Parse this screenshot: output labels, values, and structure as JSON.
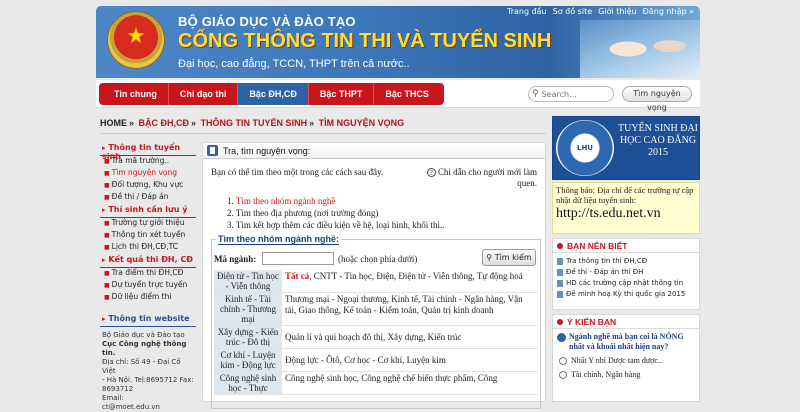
{
  "header": {
    "ministry": "BỘ GIÁO DỤC VÀ ĐÀO TẠO",
    "portal": "CỔNG THÔNG TIN THI VÀ TUYỂN SINH",
    "subtitle": "Đại học, cao đẳng, TCCN, THPT trên cả nước..",
    "top_links": [
      "Trang đầu",
      "Sơ đồ site",
      "Giới thiệu",
      "Đăng nhập »"
    ]
  },
  "nav": {
    "tabs": [
      "Tin chung",
      "Chỉ đạo thi",
      "Bậc ĐH,CĐ",
      "Bậc THPT",
      "Bậc THCS"
    ],
    "active": "Bậc ĐH,CĐ",
    "search_placeholder": "Search...",
    "search_button": "Tìm nguyện vọng"
  },
  "breadcrumb": [
    "HOME",
    "BẬC ĐH,CĐ",
    "THÔNG TIN TUYỂN SINH",
    "TÌM NGUYỆN VỌNG"
  ],
  "left": {
    "sec1_title": "Thông tin tuyển sinh",
    "sec1_items": [
      "Tra mã trường..",
      "Tìm nguyện vọng",
      "Đối tượng, Khu vực",
      "Đề thi / Đáp án"
    ],
    "sec2_title": "Thí sinh cần lưu ý",
    "sec2_items": [
      "Trường tự giới thiệu",
      "Thông tin xét tuyển",
      "Lịch thi ĐH,CĐ,TC"
    ],
    "sec3_title": "Kết quả thi ĐH, CĐ",
    "sec3_items": [
      "Tra điểm thi ĐH,CĐ",
      "Dự tuyển trực tuyến",
      "Dữ liệu điểm thi"
    ],
    "sec4_title": "Thông tin website",
    "contact": [
      "Bộ Giáo dục và Đào tạo",
      "Cục Công nghệ thông tin.",
      "Địa chỉ: Số 49 - Đại Cồ Việt",
      "- Hà Nội. Tel:8695712 Fax:",
      "8693712",
      "Email:",
      "ct@moet.edu.vn"
    ]
  },
  "main": {
    "title": "Tra, tìm nguyện vọng:",
    "intro": "Bạn có thể tìm theo một trong các cách sau đây.",
    "guide_line1": "Chỉ dẫn cho người mới làm",
    "guide_line2": "quen.",
    "options": [
      "Tìm theo nhóm ngành nghề",
      "Tìm theo địa phương (nơi trường đóng)",
      "Tìm kết hợp thêm các điều kiện về hệ, loại hình, khối thi.."
    ],
    "group_title": "Tìm theo nhóm ngành nghề:",
    "filter_label": "Mã ngành:",
    "filter_hint": "(hoặc chọn phía dưới)",
    "find_button": "Tìm kiếm",
    "rows": [
      {
        "label": "Điện tử - Tin học - Viễn thông",
        "all": "Tất cả",
        "value": ", CNTT - Tin học, Điện, Điện tử - Viễn thông, Tự động hoá"
      },
      {
        "label": "Kinh tế - Tài chính - Thương mại",
        "all": "",
        "value": "Thương mại - Ngoại thương, Kinh tế, Tài chính - Ngân hàng, Vận tải, Giao thông, Kế toán - Kiểm toán, Quản trị kinh doanh"
      },
      {
        "label": "Xây dựng - Kiến trúc - Đô thị",
        "all": "",
        "value": "Quản lí và qui hoạch đô thị, Xây dựng, Kiến trúc"
      },
      {
        "label": "Cơ khí - Luyện kim - Động lực",
        "all": "",
        "value": "Động lực - Ôtô, Cơ học - Cơ khí, Luyện kim"
      },
      {
        "label": "Công nghệ sinh học - Thực",
        "all": "",
        "value": "Công nghệ sinh học, Công nghệ chế biến thực phẩm, Công"
      }
    ]
  },
  "right": {
    "university": "LHU",
    "banner_title": "TUYỂN SINH ĐẠI HỌC CAO ĐẲNG 2015",
    "notice_text": "Thông báo: Địa chỉ để các trường tự cập nhật dữ liệu tuyển sinh:",
    "notice_url": "http://ts.edu.net.vn",
    "news_title": "BẠN NÊN BIẾT",
    "news": [
      "Tra thông tin thi ĐH,CĐ",
      "Đề thi - Đáp án thi ĐH",
      "HD các trường cập nhật thông tin",
      "Đề minh hoạ Kỳ thi quốc gia 2015"
    ],
    "poll_title": "Ý KIẾN BẠN",
    "poll_question": "Ngành nghề mà bạn coi là NÓNG nhất và khoái nhất hiện nay?",
    "poll_options": [
      "Nhất Y nhì Dược tam được..",
      "Tài chính, Ngân hàng"
    ]
  },
  "colors": {
    "brand_red": "#c8161d",
    "brand_blue": "#2f62a2",
    "header_title": "#ffdd33"
  }
}
